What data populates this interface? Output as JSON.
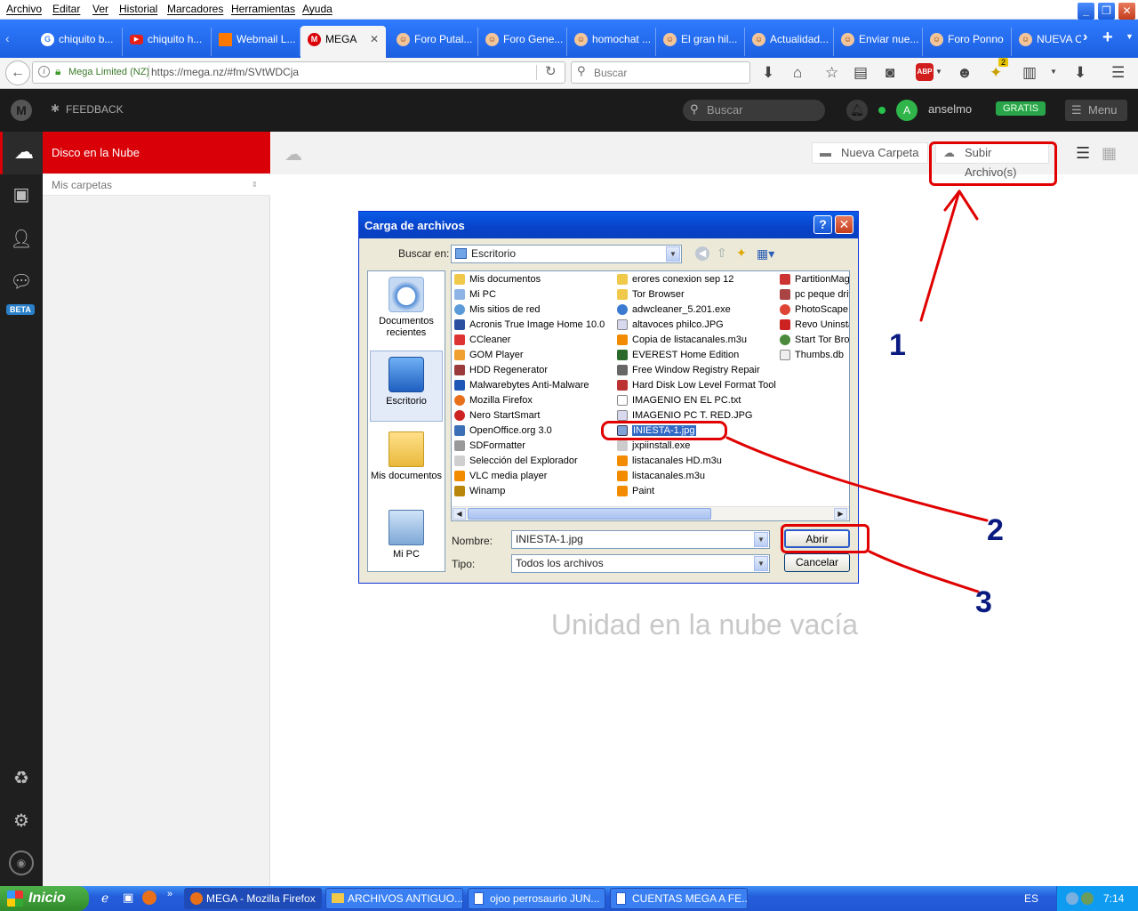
{
  "menubar": {
    "items": [
      "Archivo",
      "Editar",
      "Ver",
      "Historial",
      "Marcadores",
      "Herramientas",
      "Ayuda"
    ]
  },
  "tabs": [
    {
      "label": "chiquito b...",
      "icon": "google-icon"
    },
    {
      "label": "chiquito h...",
      "icon": "youtube-icon"
    },
    {
      "label": "Webmail L...",
      "icon": "orange-icon"
    },
    {
      "label": "MEGA",
      "icon": "mega-icon",
      "active": true
    },
    {
      "label": "Foro Putal...",
      "icon": "forum-icon"
    },
    {
      "label": "Foro Gene...",
      "icon": "forum-icon"
    },
    {
      "label": "homochat ...",
      "icon": "forum-icon"
    },
    {
      "label": "El gran hil...",
      "icon": "forum-icon"
    },
    {
      "label": "Actualidad...",
      "icon": "forum-icon"
    },
    {
      "label": "Enviar nue...",
      "icon": "forum-icon"
    },
    {
      "label": "Foro Ponno",
      "icon": "forum-icon"
    },
    {
      "label": "NUEVA CU",
      "icon": "forum-icon"
    }
  ],
  "navbar": {
    "site_identity": "Mega Limited (NZ)",
    "url": "https://mega.nz/#fm/SVtWDCja",
    "search_placeholder": "Buscar",
    "badge_count": "2",
    "abp": "ABP"
  },
  "mega_header": {
    "feedback": "FEEDBACK",
    "search_placeholder": "Buscar",
    "avatar_letter": "A",
    "username": "anselmo",
    "plan": "GRATIS",
    "menu": "Menu"
  },
  "sidebar": {
    "beta": "BETA",
    "section_title": "Disco en la Nube",
    "folders_label": "Mis carpetas"
  },
  "toolbar": {
    "new_folder": "Nueva Carpeta",
    "upload": "Subir Archivo(s)"
  },
  "main": {
    "empty_text": "Unidad en la nube vacía"
  },
  "dialog": {
    "title": "Carga de archivos",
    "look_in_label": "Buscar en:",
    "look_in_value": "Escritorio",
    "places": [
      "Documentos recientes",
      "Escritorio",
      "Mis documentos",
      "Mi PC"
    ],
    "files_col1": [
      "Mis documentos",
      "Mi PC",
      "Mis sitios de red",
      "Acronis True Image Home 10.0",
      "CCleaner",
      "GOM Player",
      "HDD Regenerator",
      "Malwarebytes Anti-Malware",
      "Mozilla Firefox",
      "Nero StartSmart",
      "OpenOffice.org 3.0",
      "SDFormatter",
      "Selección del Explorador",
      "VLC media player",
      "Winamp"
    ],
    "files_col2": [
      "erores conexion sep 12",
      "Tor Browser",
      "adwcleaner_5.201.exe",
      "altavoces philco.JPG",
      "Copia de listacanales.m3u",
      "EVEREST Home Edition",
      "Free Window Registry Repair",
      "Hard Disk Low Level Format Tool",
      "IMAGENIO EN EL PC.txt",
      "IMAGENIO PC T. RED.JPG",
      "INIESTA-1.jpg",
      "jxpiinstall.exe",
      "listacanales HD.m3u",
      "listacanales.m3u",
      "Paint"
    ],
    "files_col3": [
      "PartitionMagi",
      "pc peque driv",
      "PhotoScape",
      "Revo Uninsta",
      "Start Tor Bro",
      "Thumbs.db"
    ],
    "selected_file": "INIESTA-1.jpg",
    "name_label": "Nombre:",
    "name_value": "INIESTA-1.jpg",
    "type_label": "Tipo:",
    "type_value": "Todos los archivos",
    "open_button": "Abrir",
    "cancel_button": "Cancelar"
  },
  "annotations": [
    "1",
    "2",
    "3"
  ],
  "taskbar": {
    "start": "Inicio",
    "items": [
      "MEGA - Mozilla Firefox",
      "ARCHIVOS ANTIGUO...",
      "ojoo perrosaurio JUN...",
      "CUENTAS MEGA A FE..."
    ],
    "lang": "ES",
    "clock": "7:14"
  },
  "colors": {
    "mega_red": "#d90007",
    "xp_blue": "#0a5ce8",
    "annotation_red": "#e00000",
    "annotation_blue": "#0a1a80"
  }
}
